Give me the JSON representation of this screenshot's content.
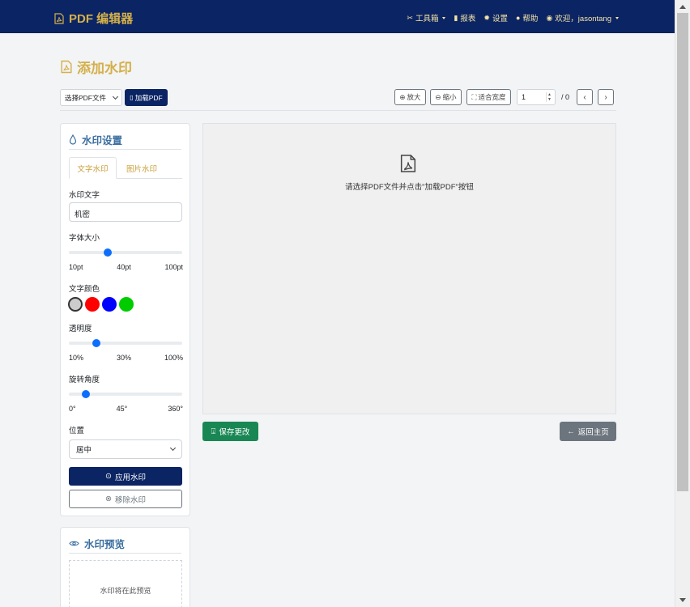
{
  "navbar": {
    "brand": "PDF 编辑器",
    "items": [
      {
        "label": "工具箱",
        "icon": "tools-icon"
      },
      {
        "label": "报表",
        "icon": "chart-icon"
      },
      {
        "label": "设置",
        "icon": "gear-icon"
      },
      {
        "label": "帮助",
        "icon": "help-icon"
      },
      {
        "label": "欢迎，jasontang",
        "icon": "user-icon"
      }
    ]
  },
  "page": {
    "title": "添加水印"
  },
  "toolbar": {
    "select_file": "选择PDF文件",
    "load_pdf": "加载PDF",
    "zoom_in": "放大",
    "zoom_out": "缩小",
    "fit_width": "适合宽度",
    "page_value": "1",
    "page_total": "/ 0"
  },
  "settings": {
    "title": "水印设置",
    "tabs": [
      "文字水印",
      "图片水印"
    ],
    "text_label": "水印文字",
    "text_value": "机密",
    "font_size": {
      "label": "字体大小",
      "min": "10pt",
      "mid": "40pt",
      "max": "100pt",
      "value": 40
    },
    "color": {
      "label": "文字颜色",
      "options": [
        "#cccccc",
        "#ff0000",
        "#0000ff",
        "#00cc00"
      ],
      "selected": "#cccccc"
    },
    "opacity": {
      "label": "透明度",
      "min": "10%",
      "mid": "30%",
      "max": "100%",
      "value": 30
    },
    "rotation": {
      "label": "旋转角度",
      "min": "0°",
      "mid": "45°",
      "max": "360°",
      "value": 45
    },
    "position": {
      "label": "位置",
      "value": "居中"
    },
    "apply": "应用水印",
    "remove": "移除水印"
  },
  "preview": {
    "title": "水印预览",
    "placeholder": "水印将在此预览"
  },
  "viewer": {
    "message": "请选择PDF文件并点击\"加载PDF\"按钮"
  },
  "actions": {
    "save": "保存更改",
    "back": "返回主页"
  }
}
